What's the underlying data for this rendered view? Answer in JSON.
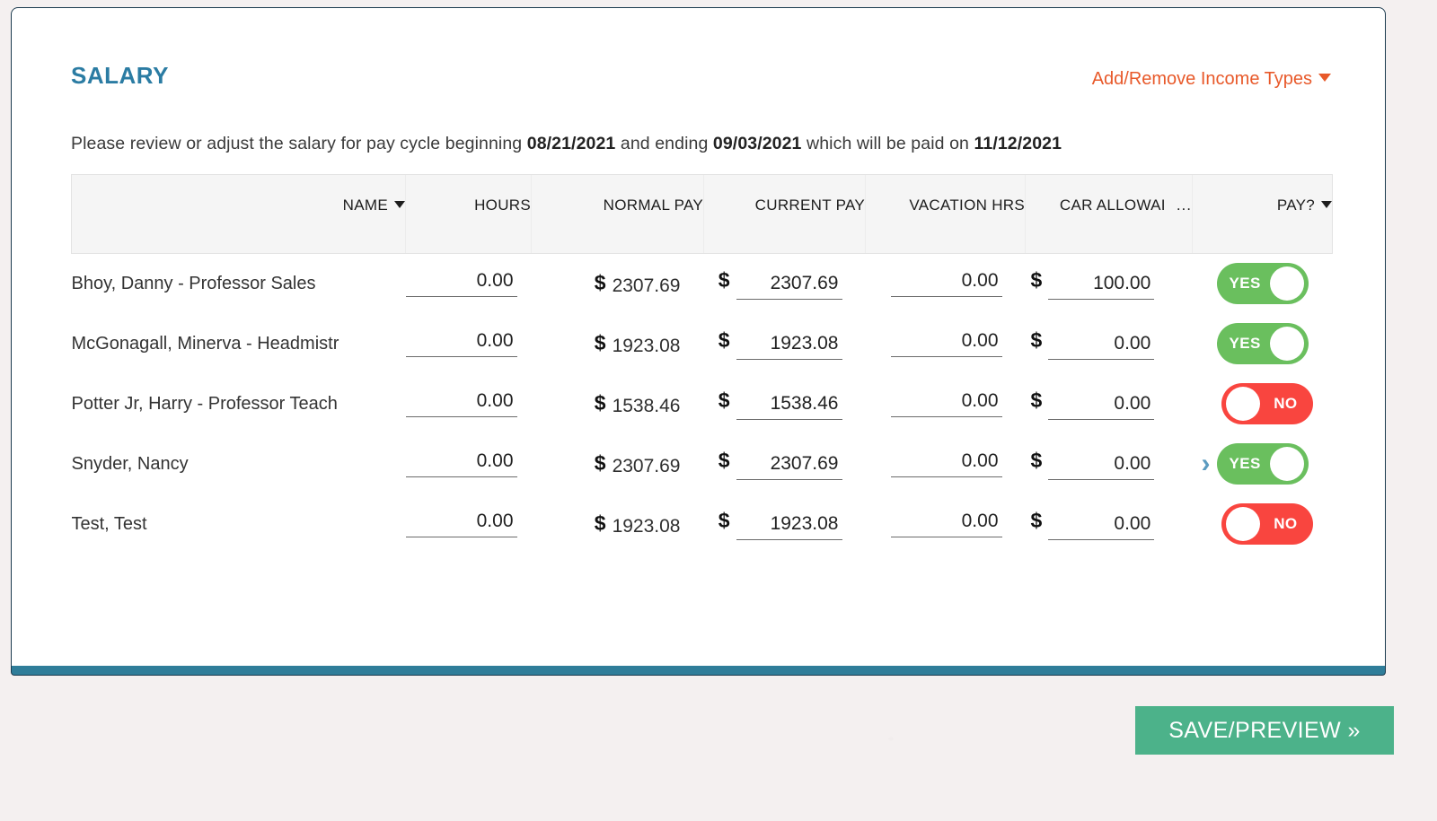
{
  "header": {
    "title": "SALARY",
    "income_types_link": "Add/Remove Income Types",
    "accent_title_color": "#2b7ca3",
    "accent_link_color": "#e8592a"
  },
  "subtitle": {
    "lead": "Please review or adjust the salary for pay cycle beginning ",
    "begin_date": "08/21/2021",
    "mid": " and ending ",
    "end_date": "09/03/2021",
    "tail": " which will be paid on ",
    "paid_date": "11/12/2021"
  },
  "table": {
    "columns": [
      {
        "key": "name",
        "label": "NAME",
        "sortable": true
      },
      {
        "key": "hours",
        "label": "HOURS",
        "sortable": false
      },
      {
        "key": "normal",
        "label": "NORMAL PAY",
        "sortable": false
      },
      {
        "key": "curr",
        "label": "CURRENT PAY",
        "sortable": false
      },
      {
        "key": "vac",
        "label": "VACATION HRS",
        "sortable": false
      },
      {
        "key": "car",
        "label": "CAR ALLOWAI",
        "truncated_marker": "...",
        "sortable": false
      },
      {
        "key": "pay",
        "label": "PAY?",
        "sortable": true
      }
    ],
    "rows": [
      {
        "name": "Bhoy, Danny - Professor Sales",
        "hours": "0.00",
        "normal_pay": "2307.69",
        "current_pay": "2307.69",
        "vacation_hrs": "0.00",
        "car_allowance": "100.00",
        "pay": "YES",
        "pay_on": true,
        "has_chevron": false
      },
      {
        "name": "McGonagall, Minerva - Headmistr",
        "hours": "0.00",
        "normal_pay": "1923.08",
        "current_pay": "1923.08",
        "vacation_hrs": "0.00",
        "car_allowance": "0.00",
        "pay": "YES",
        "pay_on": true,
        "has_chevron": false
      },
      {
        "name": "Potter Jr, Harry - Professor Teach",
        "hours": "0.00",
        "normal_pay": "1538.46",
        "current_pay": "1538.46",
        "vacation_hrs": "0.00",
        "car_allowance": "0.00",
        "pay": "NO",
        "pay_on": false,
        "has_chevron": false
      },
      {
        "name": "Snyder, Nancy",
        "hours": "0.00",
        "normal_pay": "2307.69",
        "current_pay": "2307.69",
        "vacation_hrs": "0.00",
        "car_allowance": "0.00",
        "pay": "YES",
        "pay_on": true,
        "has_chevron": true
      },
      {
        "name": "Test, Test",
        "hours": "0.00",
        "normal_pay": "1923.08",
        "current_pay": "1923.08",
        "vacation_hrs": "0.00",
        "car_allowance": "0.00",
        "pay": "NO",
        "pay_on": false,
        "has_chevron": false
      }
    ],
    "currency_symbol": "$",
    "next_page_chevron": "›"
  },
  "footer": {
    "save_button": "SAVE/PREVIEW »",
    "save_button_color": "#4cb28a"
  }
}
